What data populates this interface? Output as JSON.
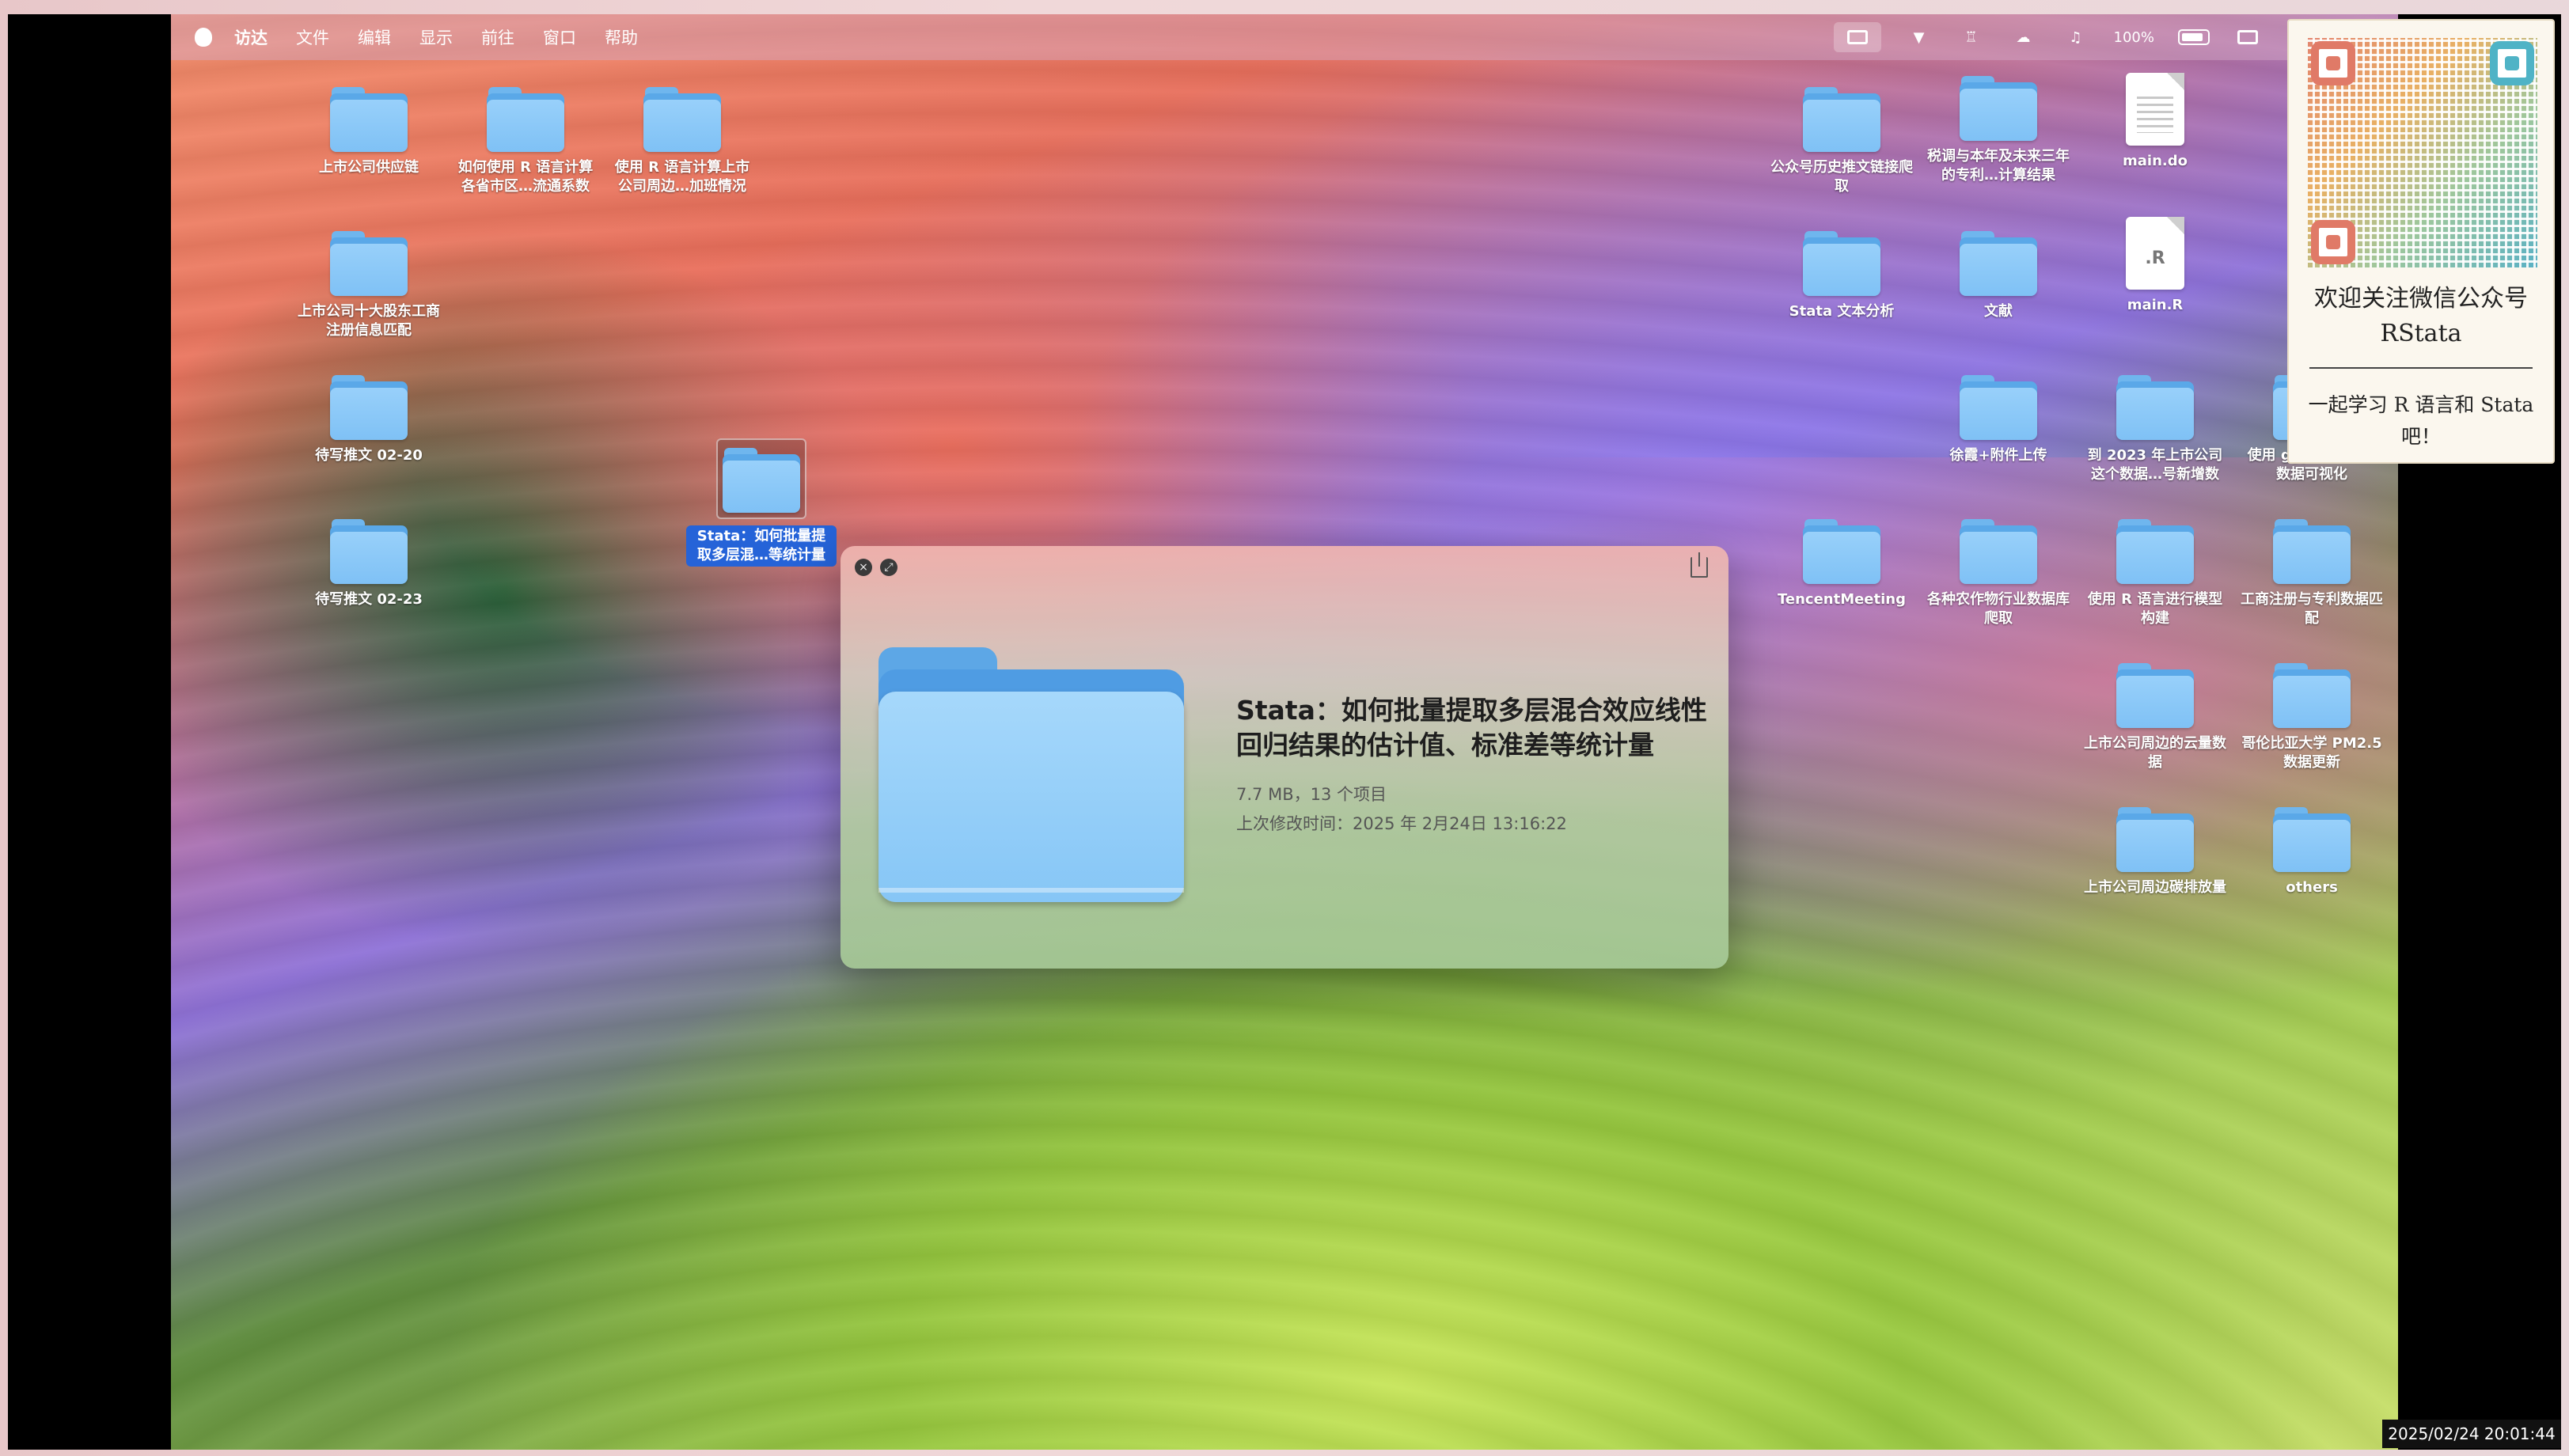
{
  "menubar": {
    "items": [
      "访达",
      "文件",
      "编辑",
      "显示",
      "前往",
      "窗口",
      "帮助"
    ],
    "battery_percent": "100%"
  },
  "desktop_icons": [
    {
      "label": "上市公司供应链",
      "type": "folder"
    },
    {
      "label": "如何使用 R 语言计算各省市区…流通系数",
      "type": "folder"
    },
    {
      "label": "使用 R 语言计算上市公司周边…加班情况",
      "type": "folder"
    },
    {
      "label": "上市公司十大股东工商注册信息匹配",
      "type": "folder"
    },
    {
      "label": "待写推文 02-20",
      "type": "folder"
    },
    {
      "label": "待写推文 02-23",
      "type": "folder"
    },
    {
      "label": "Stata：如何批量提取多层混…等统计量",
      "type": "folder",
      "selected": true
    },
    {
      "label": "公众号历史推文链接爬取",
      "type": "folder"
    },
    {
      "label": "税调与本年及未来三年的专利…计算结果",
      "type": "folder"
    },
    {
      "label": "main.do",
      "type": "document",
      "ext": ""
    },
    {
      "label": "Stata 文本分析",
      "type": "folder"
    },
    {
      "label": "文献",
      "type": "folder"
    },
    {
      "label": "main.R",
      "type": "document",
      "ext": ".R"
    },
    {
      "label": "徐霞+附件上传",
      "type": "folder"
    },
    {
      "label": "到 2023 年上市公司这个数据…号新增数",
      "type": "folder"
    },
    {
      "label": "使用 ggplot2 进行数据可视化",
      "type": "folder"
    },
    {
      "label": "TencentMeeting",
      "type": "folder"
    },
    {
      "label": "各种农作物行业数据库爬取",
      "type": "folder"
    },
    {
      "label": "使用 R 语言进行模型构建",
      "type": "folder"
    },
    {
      "label": "工商注册与专利数据匹配",
      "type": "folder"
    },
    {
      "label": "上市公司周边的云量数据",
      "type": "folder"
    },
    {
      "label": "哥伦比亚大学 PM2.5 数据更新",
      "type": "folder"
    },
    {
      "label": "上市公司周边碳排放量",
      "type": "folder"
    },
    {
      "label": "others",
      "type": "folder"
    }
  ],
  "quicklook": {
    "title": "Stata：如何批量提取多层混合效应线性回归结果的估计值、标准差等统计量",
    "size_items": "7.7 MB，13 个项目",
    "modified": "上次修改时间：2025 年 2月24日 13:16:22"
  },
  "promo": {
    "line1": "欢迎关注微信公众号 RStata",
    "line2": "一起学习 R 语言和 Stata 吧！"
  },
  "timestamp": "2025/02/24 20:01:44"
}
